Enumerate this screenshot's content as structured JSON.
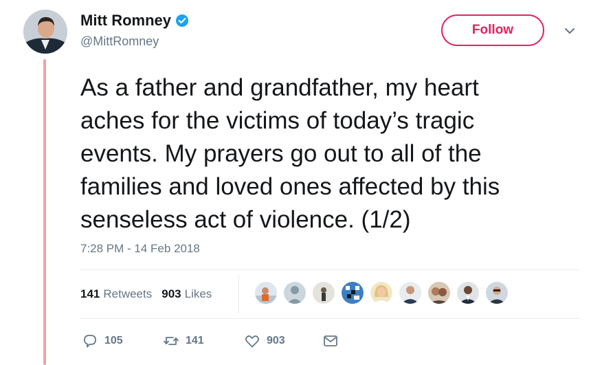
{
  "author": {
    "display_name": "Mitt Romney",
    "handle": "@MittRomney",
    "verified": true,
    "avatar": "profile-photo",
    "verified_icon": "verified-badge-icon"
  },
  "follow_label": "Follow",
  "tweet": {
    "text": "As a father and grandfather, my heart\naches for the victims of today’s tragic\nevents. My prayers go out to all of the\nfamilies and loved ones affected by this\nsenseless act of violence. (1/2)",
    "timestamp": "7:28 PM - 14 Feb 2018"
  },
  "stats": {
    "retweets_count": "141",
    "retweets_label": "Retweets",
    "likes_count": "903",
    "likes_label": "Likes"
  },
  "actions": {
    "reply": {
      "icon": "reply-icon",
      "count": "105"
    },
    "retweet": {
      "icon": "retweet-icon",
      "count": "141"
    },
    "like": {
      "icon": "heart-icon",
      "count": "903"
    },
    "message": {
      "icon": "direct-message-icon"
    }
  },
  "liker_avatars": 9,
  "colors": {
    "accent": "#e0245e",
    "verified": "#1da1f2",
    "secondary_text": "#657786",
    "thread_line": "#f4a0a8"
  }
}
